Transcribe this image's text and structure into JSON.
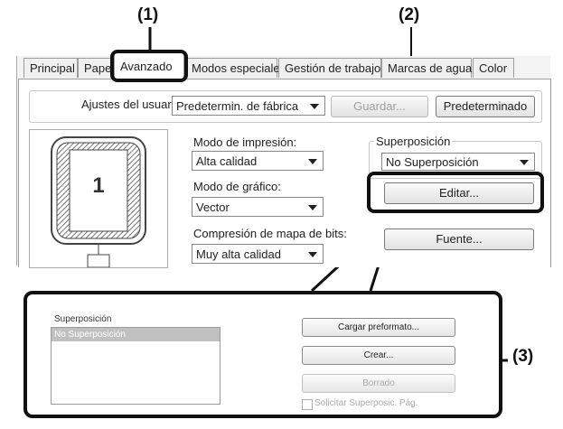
{
  "callouts": {
    "c1": "(1)",
    "c2": "(2)",
    "c3": "(3)"
  },
  "tabs": [
    {
      "label": "Principal"
    },
    {
      "label": "Pape"
    },
    {
      "label": "Avanzado"
    },
    {
      "label": "Modos especiales"
    },
    {
      "label": "Gestión de trabajos"
    },
    {
      "label": "Marcas de agua"
    },
    {
      "label": "Color"
    }
  ],
  "user_settings": {
    "label": "Ajustes del usuario:",
    "value": "Predetermin. de fábrica",
    "save_label": "Guardar...",
    "default_label": "Predeterminado"
  },
  "preview": {
    "page_number": "1"
  },
  "print_mode": {
    "label": "Modo de impresión:",
    "value": "Alta calidad"
  },
  "graphic_mode": {
    "label": "Modo de gráfico:",
    "value": "Vector"
  },
  "bitmap_compression": {
    "label": "Compresión de mapa de bits:",
    "value": "Muy alta calidad"
  },
  "overlay": {
    "label": "Superposición",
    "value": "No Superposición",
    "edit_label": "Editar...",
    "font_label": "Fuente..."
  },
  "overlay_dialog": {
    "group_label": "Superposición",
    "list_items": [
      "No Superposición"
    ],
    "load_label": "Cargar preformato...",
    "create_label": "Crear...",
    "delete_label": "Borrado",
    "request_label": "Solicitar Superposic. Pág."
  },
  "colors": {
    "selected_list_item": "#c0c0c0",
    "highlight_border": "#111111"
  }
}
